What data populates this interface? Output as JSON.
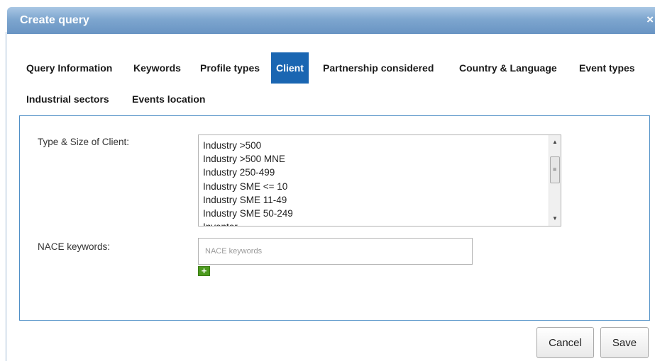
{
  "dialog": {
    "title": "Create query",
    "close_glyph": "×"
  },
  "tabs": [
    {
      "label": "Query Information",
      "active": false
    },
    {
      "label": "Keywords",
      "active": false
    },
    {
      "label": "Profile types",
      "active": false
    },
    {
      "label": "Client",
      "active": true
    },
    {
      "label": "Partnership considered",
      "active": false
    },
    {
      "label": "Country & Language",
      "active": false
    },
    {
      "label": "Event types",
      "active": false
    },
    {
      "label": "Industrial sectors",
      "active": false
    },
    {
      "label": "Events location",
      "active": false
    }
  ],
  "client_panel": {
    "type_size_label": "Type & Size of Client:",
    "type_size_options": [
      "Industry >500",
      "Industry >500 MNE",
      "Industry 250-499",
      "Industry SME <= 10",
      "Industry SME 11-49",
      "Industry SME 50-249",
      "Inventor"
    ],
    "nace_label": "NACE keywords:",
    "nace_placeholder": "NACE keywords",
    "nace_value": "",
    "add_glyph": "+"
  },
  "footer": {
    "cancel_label": "Cancel",
    "save_label": "Save"
  },
  "colors": {
    "titlebar": "#7ea6cf",
    "active_tab": "#1a66b2",
    "panel_border": "#4f8fc6",
    "add_button": "#4c9a1e"
  }
}
